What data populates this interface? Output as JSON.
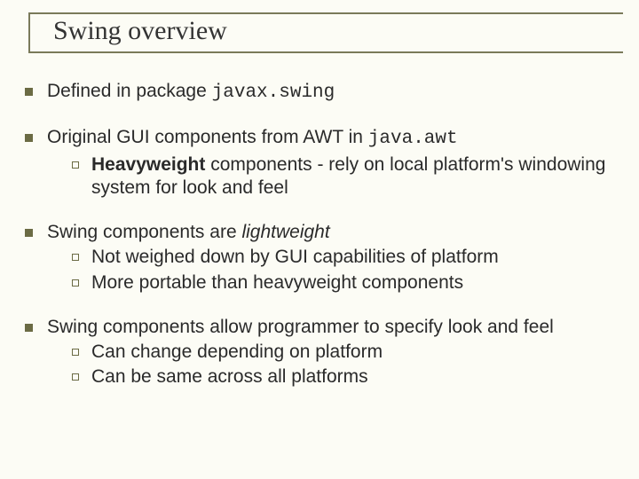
{
  "title": "Swing overview",
  "b1": {
    "pre": "Defined in package ",
    "code": "javax.swing"
  },
  "b2": {
    "pre": "Original GUI components from AWT in ",
    "code": "java.awt",
    "s1bold": "Heavyweight",
    "s1rest": " components - rely on local platform's windowing system for look and feel"
  },
  "b3": {
    "pre": "Swing components are ",
    "ital": "lightweight",
    "s1": "Not weighed down by GUI capabilities of platform",
    "s2": "More portable than heavyweight components"
  },
  "b4": {
    "main": "Swing components allow programmer to specify look and feel",
    "s1": "Can change depending on platform",
    "s2": "Can be same across all platforms"
  }
}
